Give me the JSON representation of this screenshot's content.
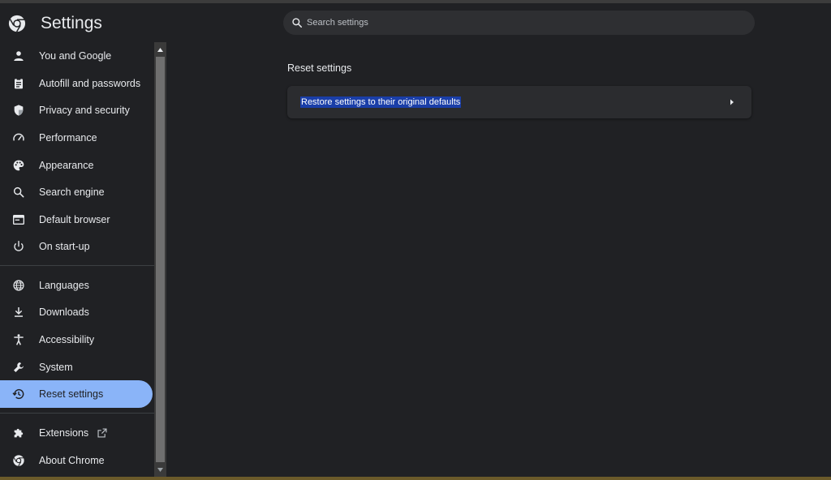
{
  "app": {
    "title": "Settings"
  },
  "search": {
    "placeholder": "Search settings"
  },
  "sidebar": {
    "items": [
      {
        "label": "You and Google",
        "icon": "person-icon"
      },
      {
        "label": "Autofill and passwords",
        "icon": "clipboard-icon"
      },
      {
        "label": "Privacy and security",
        "icon": "shield-icon"
      },
      {
        "label": "Performance",
        "icon": "speedometer-icon"
      },
      {
        "label": "Appearance",
        "icon": "palette-icon"
      },
      {
        "label": "Search engine",
        "icon": "search-icon"
      },
      {
        "label": "Default browser",
        "icon": "browser-icon"
      },
      {
        "label": "On start-up",
        "icon": "power-icon"
      },
      {
        "label": "Languages",
        "icon": "globe-icon"
      },
      {
        "label": "Downloads",
        "icon": "download-icon"
      },
      {
        "label": "Accessibility",
        "icon": "accessibility-icon"
      },
      {
        "label": "System",
        "icon": "wrench-icon"
      },
      {
        "label": "Reset settings",
        "icon": "restore-icon",
        "active": true
      },
      {
        "label": "Extensions",
        "icon": "puzzle-icon"
      },
      {
        "label": "About Chrome",
        "icon": "chrome-icon"
      }
    ]
  },
  "main": {
    "section_title": "Reset settings",
    "card_label": "Restore settings to their original defaults"
  },
  "colors": {
    "background": "#202124",
    "active_accent": "#8ab4f8",
    "selection": "#1a3ea8",
    "card": "#2b2c2f"
  }
}
